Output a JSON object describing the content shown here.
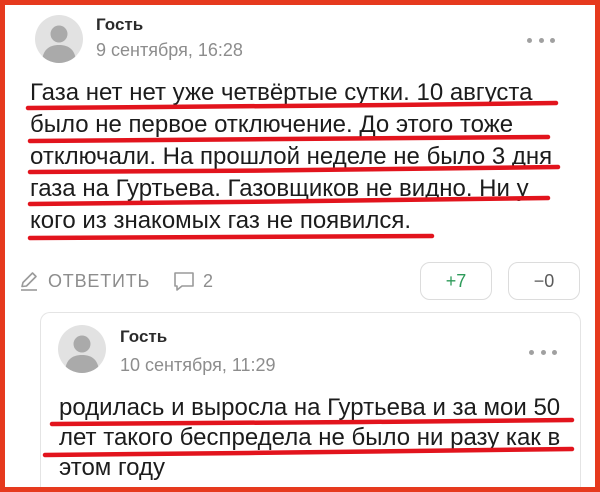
{
  "colors": {
    "frame": "#e63a1e",
    "underline": "#e2141d",
    "upvote": "#2e9b5a",
    "muted": "#8d8d8d"
  },
  "comment": {
    "author": "Гость",
    "date": "9 сентября, 16:28",
    "icons": {
      "avatar": "user-avatar-icon",
      "more": "more-dots-icon"
    },
    "text_lines": [
      "Газа нет нет уже четвёртые сутки. 10 августа",
      "было не первое отключение. До этого тоже",
      "отключали. На прошлой неделе не было 3 дня",
      "газа на Гуртьева. Газовщиков не видно. Ни у",
      "кого из знакомых газ не появился."
    ],
    "actions": {
      "reply_icon": "pencil-icon",
      "reply_label": "ОТВЕТИТЬ",
      "replies_icon": "comment-bubble-icon",
      "replies_count": "2",
      "upvote_label": "+7",
      "downvote_label": "−0"
    }
  },
  "reply": {
    "author": "Гость",
    "date": "10 сентября, 11:29",
    "icons": {
      "avatar": "user-avatar-icon",
      "more": "more-dots-icon"
    },
    "text_lines": [
      "родилась и выросла на Гуртьева и за мои 50",
      "лет такого беспредела не было ни разу как в",
      "этом году"
    ]
  }
}
